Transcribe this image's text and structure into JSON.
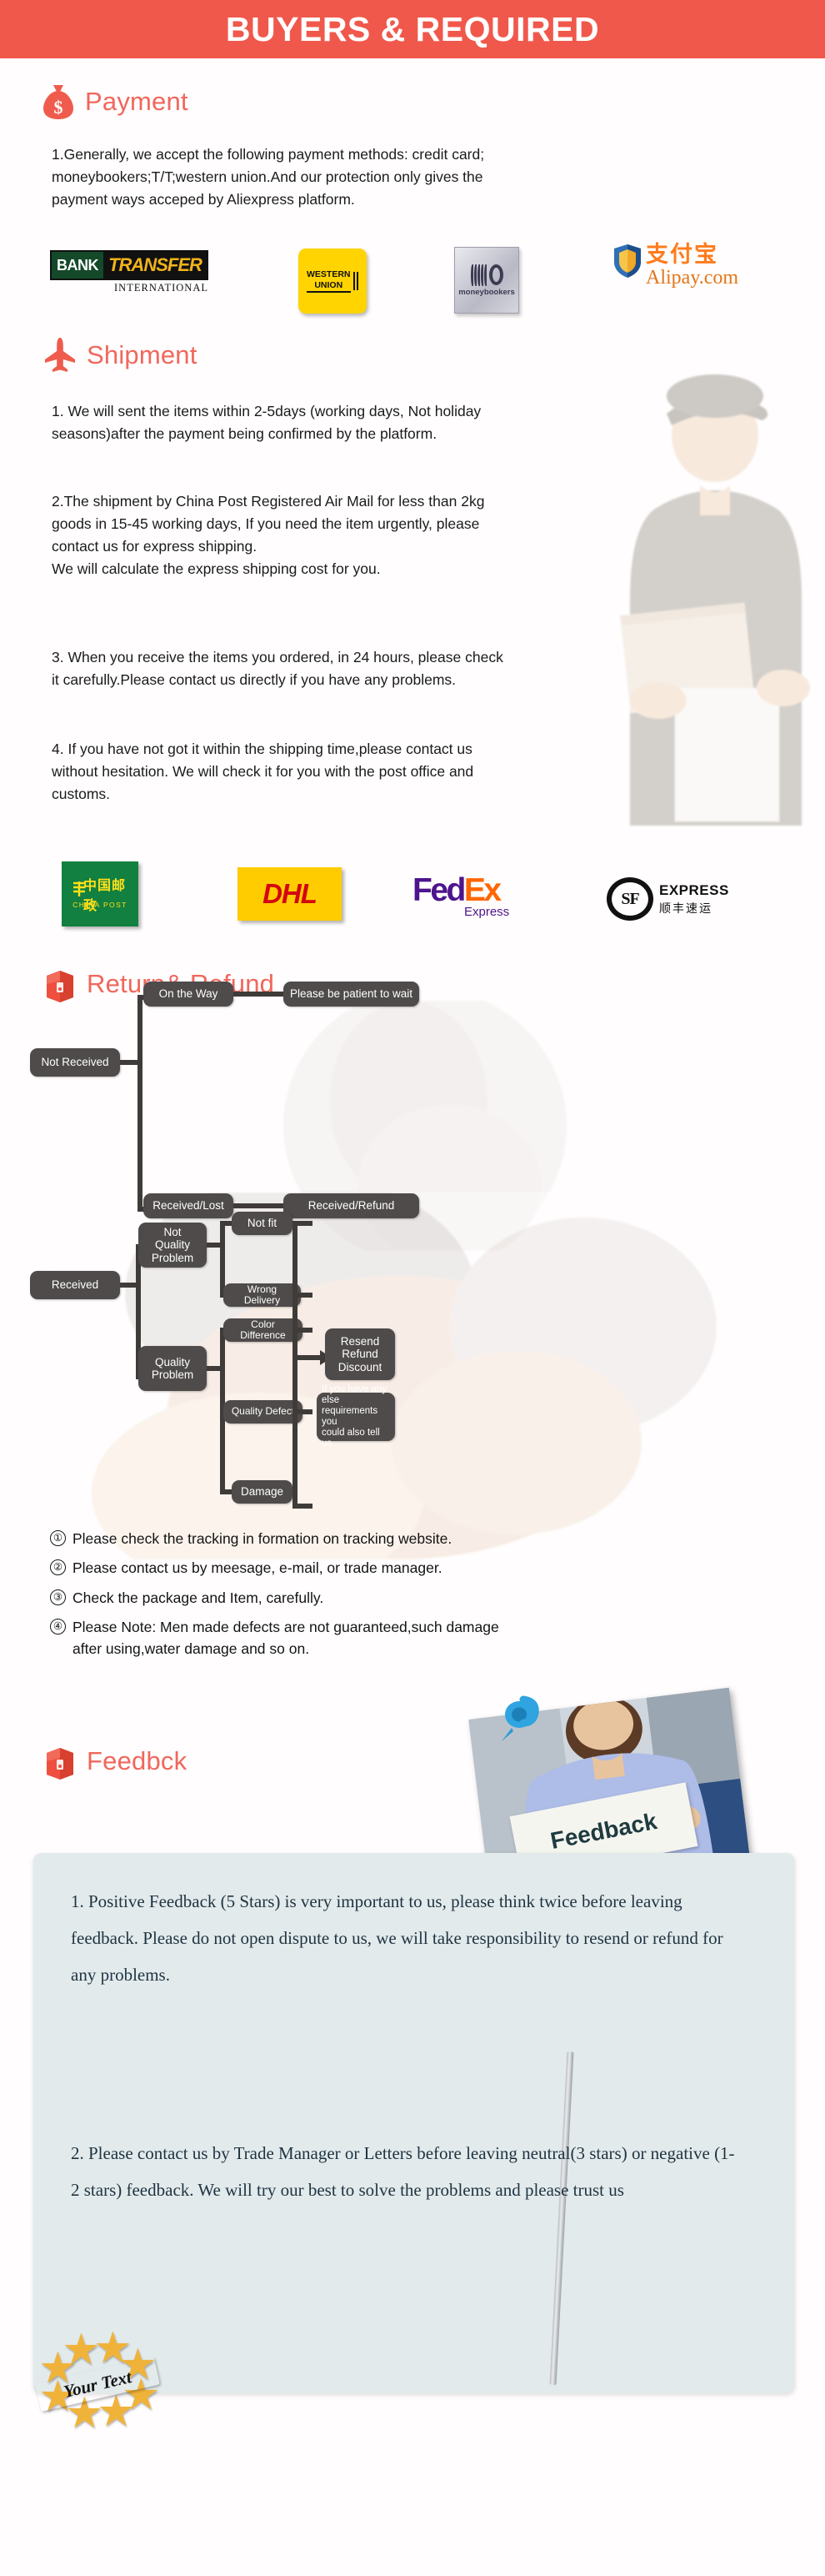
{
  "banner": {
    "title": "BUYERS & REQUIRED"
  },
  "colors": {
    "banner_bg": "#f0584c",
    "heading": "#f0675c",
    "flow_node_bg": "#4f4b4b",
    "feedback_panel_bg": "#e2eaec",
    "body_text": "#1b1b1b"
  },
  "sections": {
    "payment": {
      "icon": "money-bag-icon",
      "heading": "Payment",
      "paragraph": "1.Generally, we accept the following payment methods: credit card;\nmoneybookers;T/T;western union.And our protection only gives the\npayment ways acceped by Aliexpress platform.",
      "logos": [
        {
          "name": "bank-transfer-logo",
          "primary": "BANK",
          "secondary": "TRANSFER",
          "sub": "INTERNATIONAL"
        },
        {
          "name": "western-union-logo",
          "line1": "WESTERN",
          "line2": "UNION"
        },
        {
          "name": "moneybookers-logo",
          "label": "moneybookers"
        },
        {
          "name": "alipay-logo",
          "cn": "支付宝",
          "en": "Alipay.com"
        }
      ]
    },
    "shipment": {
      "icon": "airplane-icon",
      "heading": "Shipment",
      "paragraph_1": "1. We will sent the items within 2-5days (working days, Not holiday\nseasons)after the payment being confirmed by the platform.",
      "paragraph_2": "2.The shipment by China Post Registered Air Mail for less than  2kg\ngoods in 15-45 working days, If  you need the item urgently, please\ncontact us for express shipping.\nWe will calculate the express shipping cost for you.",
      "paragraph_3": "3. When you receive the items you ordered, in 24 hours, please check\n it carefully.Please contact us directly if you have any problems.",
      "paragraph_4": "4. If you have not got it within the shipping time,please contact us\nwithout hesitation. We will check it for you with the post office and\ncustoms.",
      "carriers": [
        {
          "name": "china-post-logo",
          "cn": "中国邮政",
          "en": "CHINA POST"
        },
        {
          "name": "dhl-logo",
          "label": "DHL"
        },
        {
          "name": "fedex-logo",
          "part1": "Fed",
          "part2": "Ex",
          "sub": "Express"
        },
        {
          "name": "sf-express-logo",
          "mark": "SF",
          "en": "EXPRESS",
          "cn": "顺丰速运"
        }
      ]
    },
    "return_refund": {
      "icon": "package-box-icon",
      "heading": "Return& Refund",
      "flow_top": {
        "root": "Not Received",
        "branches": [
          "On the Way",
          "Received/Lost"
        ],
        "outcomes": [
          "Please be patient to wait",
          "Received/Refund"
        ]
      },
      "flow_bottom": {
        "root": "Received",
        "categories": [
          "Not\nQuality\nProblem",
          "Quality\nProblem"
        ],
        "not_quality_reasons": [
          "Not fit",
          "Wrong Delivery"
        ],
        "quality_reasons": [
          "Color Difference",
          "Quality Defect",
          "Damage"
        ],
        "outcome": "Resend\nRefund\nDiscount",
        "note": "If you have any else\nrequirements you\ncould also tell us"
      },
      "notes": [
        {
          "num": "①",
          "text": "Please check the tracking in formation on tracking website."
        },
        {
          "num": "②",
          "text": "Please contact us by meesage, e-mail, or trade manager."
        },
        {
          "num": "③",
          "text": "Check the package and Item, carefully."
        },
        {
          "num": "④",
          "text": "Please Note: Men made defects  are not guaranteed,such damage\n    after using,water damage and so on."
        }
      ]
    },
    "feedback": {
      "icon": "package-box-icon",
      "heading": "Feedbck",
      "photo_sign_label": "Feedback",
      "paragraph_1": "1. Positive Feedback (5 Stars) is very important to us, please think twice before leaving feedback. Please do not open dispute to us,   we will take responsibility to resend or refund for any problems.",
      "paragraph_2": "2. Please contact us by Trade Manager or Letters before leaving neutral(3 stars) or negative (1-2 stars) feedback. We will try our best to solve the problems and please trust us",
      "badge_label": "Your Text"
    }
  }
}
